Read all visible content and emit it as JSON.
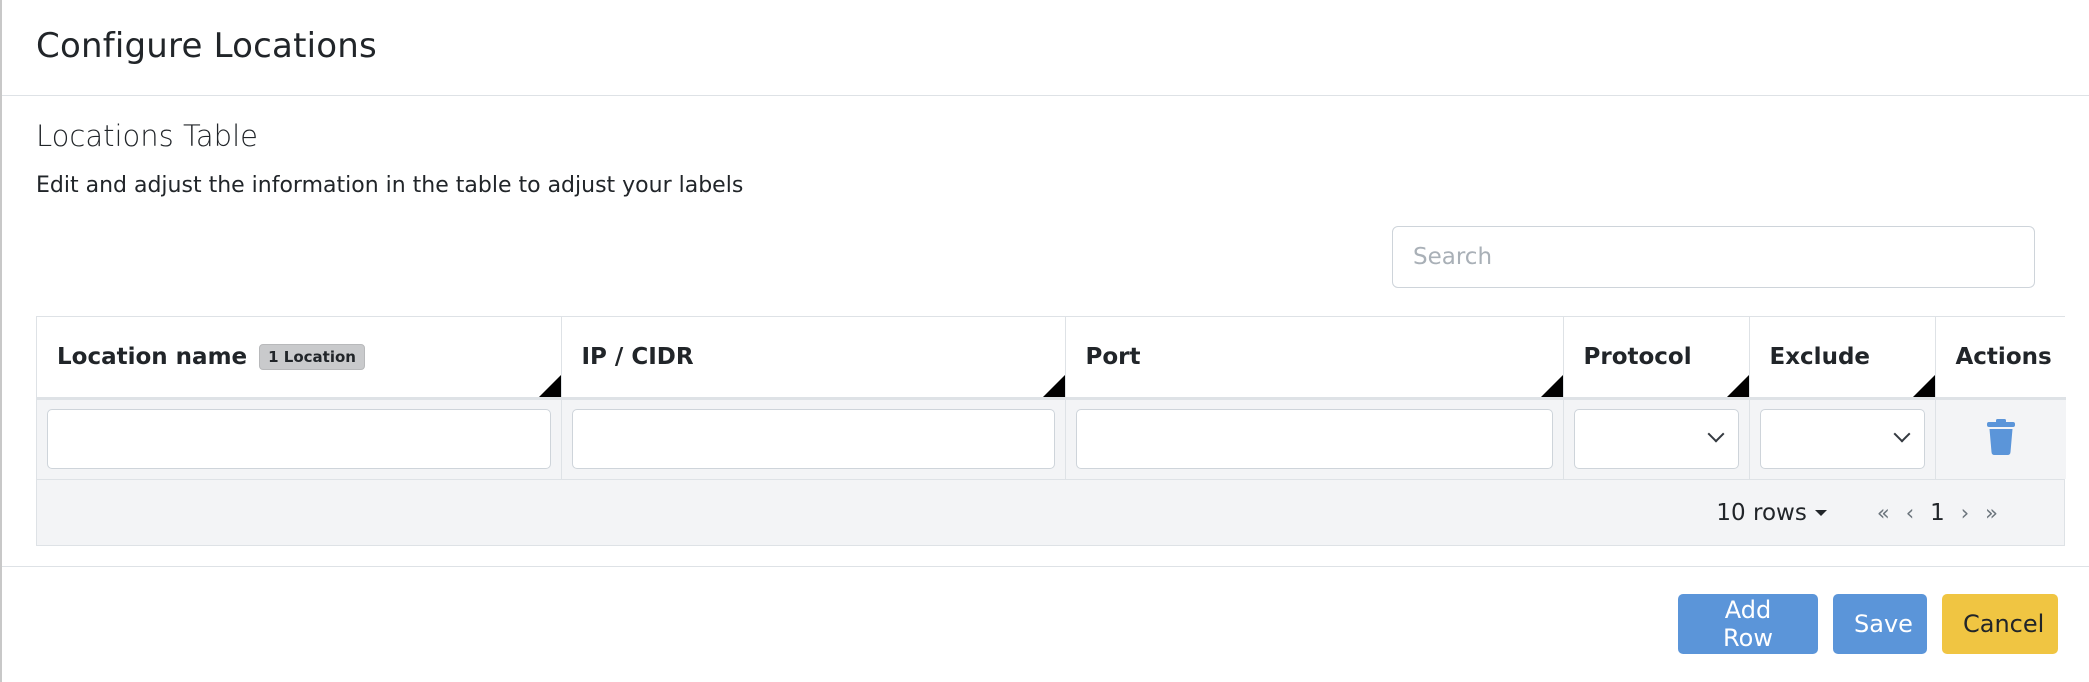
{
  "modal": {
    "title": "Configure Locations"
  },
  "section": {
    "title": "Locations Table",
    "description": "Edit and adjust the information in the table to adjust your labels"
  },
  "search": {
    "placeholder": "Search",
    "value": ""
  },
  "table": {
    "columns": [
      {
        "label": "Location name",
        "badge": "1 Location"
      },
      {
        "label": "IP / CIDR"
      },
      {
        "label": "Port"
      },
      {
        "label": "Protocol"
      },
      {
        "label": "Exclude"
      },
      {
        "label": "Actions"
      }
    ],
    "rows": [
      {
        "location_name": "",
        "ip_cidr": "",
        "port": "",
        "protocol": "",
        "exclude": ""
      }
    ],
    "icons": {
      "delete": "trash-icon",
      "sort": "sort-corner-icon",
      "select": "chevron-down-icon"
    },
    "footer": {
      "rows_per_page": "10 rows",
      "first": "«",
      "prev": "‹",
      "current_page": "1",
      "next": "›",
      "last": "»"
    }
  },
  "footer": {
    "add_row_label": "Add Row",
    "save_label": "Save",
    "cancel_label": "Cancel"
  },
  "colors": {
    "primary": "#5b95d9",
    "warning": "#f0c542",
    "trash": "#5b95d9"
  }
}
